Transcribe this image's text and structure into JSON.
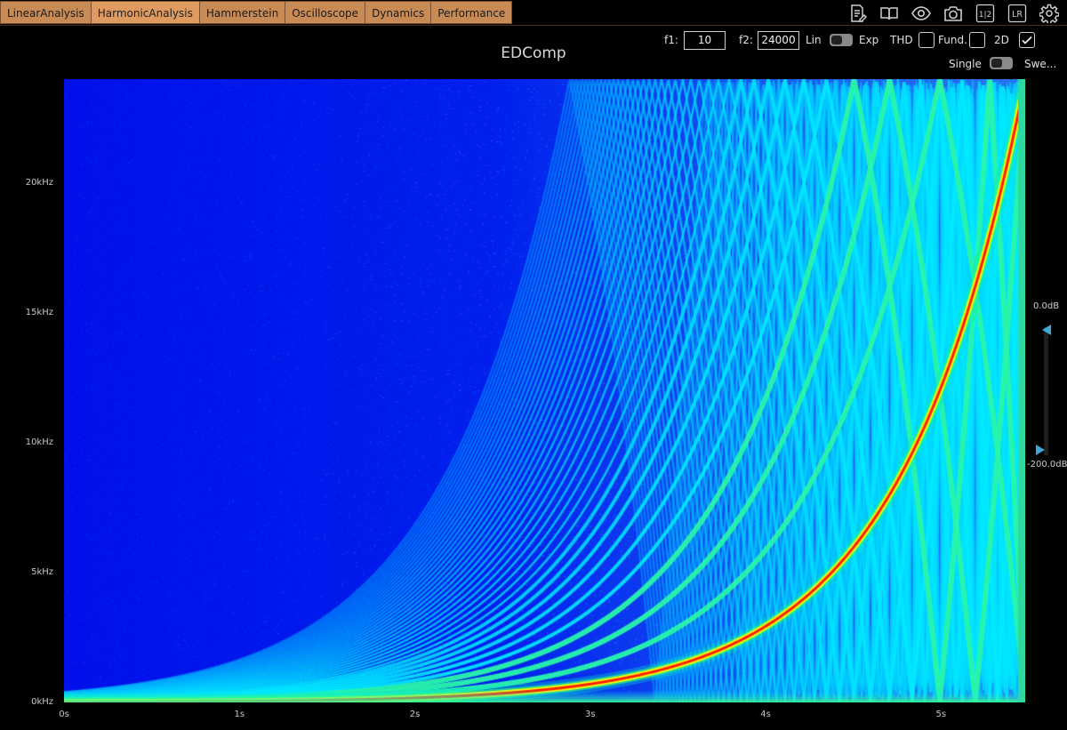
{
  "tabs": [
    {
      "label": "LinearAnalysis",
      "active": false
    },
    {
      "label": "HarmonicAnalysis",
      "active": true
    },
    {
      "label": "Hammerstein",
      "active": false
    },
    {
      "label": "Oscilloscope",
      "active": false
    },
    {
      "label": "Dynamics",
      "active": false
    },
    {
      "label": "Performance",
      "active": false
    }
  ],
  "toolbar_icons": [
    "notes-icon",
    "book-icon",
    "eye-icon",
    "camera-icon",
    "half-icon",
    "lr-icon",
    "gear-icon"
  ],
  "toolbar_text": {
    "half": "1|2",
    "lr": "LR"
  },
  "title": "EDComp",
  "controls": {
    "f1_label": "f1:",
    "f1_value": "10",
    "f2_label": "f2:",
    "f2_value": "24000",
    "lin_label": "Lin",
    "exp_label": "Exp",
    "thd_label": "THD",
    "thd_checked": false,
    "fund_label": "Fund.",
    "fund_checked": false,
    "twod_label": "2D",
    "twod_checked": true,
    "single_label": "Single",
    "sweep_label": "Swe..."
  },
  "colors": {
    "accent": "#de9a60",
    "tab": "#c98b55",
    "handle": "#3fa7d6",
    "background": "#000000"
  },
  "chart_data": {
    "type": "heatmap",
    "title": "EDComp",
    "x_ticks": [
      "0s",
      "1s",
      "2s",
      "3s",
      "4s",
      "5s"
    ],
    "y_ticks": [
      "0kHz",
      "5kHz",
      "10kHz",
      "15kHz",
      "20kHz"
    ],
    "x_range": [
      0,
      5.48
    ],
    "y_range_hz": [
      0,
      24000
    ],
    "sweep": {
      "type": "exponential",
      "f_start_hz": 10,
      "f_end_hz": 24000,
      "duration_s": 5.48
    },
    "harmonics_shown": 40,
    "colorscale": [
      "#0012ee",
      "#0080ff",
      "#00e8ff",
      "#1bf59a",
      "#ffff00",
      "#ff1000"
    ],
    "db_range": {
      "max_label": "0.0dB",
      "min_label": "-200.0dB"
    }
  }
}
